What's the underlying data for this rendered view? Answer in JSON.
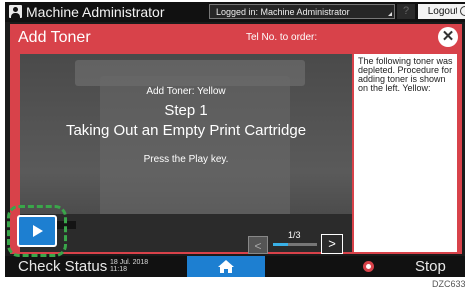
{
  "topbar": {
    "admin_label": "Machine Administrator",
    "logged_in_text": "Logged in: Machine Administrator",
    "help_label": "?",
    "logout_label": "Logout"
  },
  "dialog": {
    "title": "Add Toner",
    "tel_label": "Tel No. to order:",
    "close_symbol": "✕",
    "video": {
      "add_toner_label": "Add Toner: Yellow",
      "step_label": "Step 1",
      "step_title": "Taking Out an Empty Print Cartridge",
      "press_play": "Press the Play key.",
      "page_indicator": "1/3",
      "progress_fraction": 0.33,
      "prev_symbol": "<",
      "next_symbol": ">"
    },
    "info_text": "The following toner was depleted. Procedure for adding toner is shown on the left. Yellow:"
  },
  "bottombar": {
    "check_status_label": "Check Status",
    "date": "18 Jul. 2018",
    "time": "11:18",
    "stop_label": "Stop"
  },
  "figure_code": "DZC633",
  "colors": {
    "dialog_red": "#d8424a",
    "accent_blue": "#1d7fd1",
    "callout_green": "#3aa64a",
    "progress_blue": "#39b0e6"
  },
  "icons": {
    "admin": "person-icon",
    "close": "close-icon",
    "play": "play-icon",
    "home": "home-icon",
    "stop": "stop-icon",
    "power": "power-icon"
  }
}
